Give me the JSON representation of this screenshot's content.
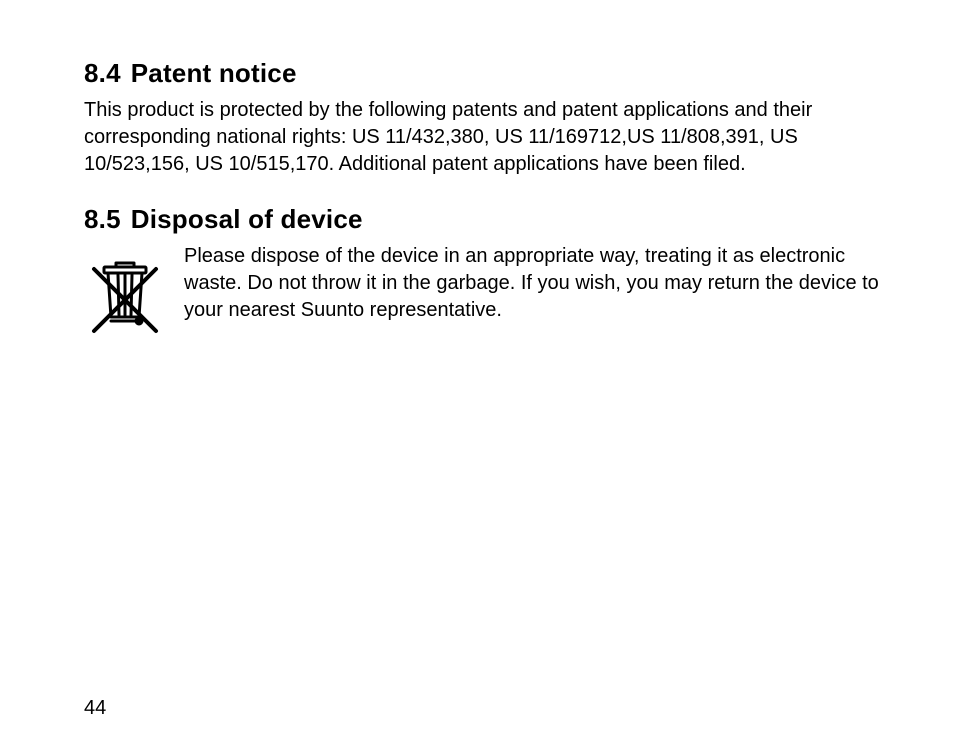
{
  "section1": {
    "number": "8.4",
    "title": "Patent notice",
    "body": "This product is protected by the following patents and patent applications and their corresponding national rights: US 11/432,380, US 11/169712,US 11/808,391, US 10/523,156, US 10/515,170. Additional patent applications have been filed."
  },
  "section2": {
    "number": "8.5",
    "title": "Disposal of device",
    "body": "Please dispose of the device in an appropriate way, treating it as electronic waste. Do not throw it in the garbage. If you wish, you may return the device to your nearest Suunto representative.",
    "icon": "weee-crossed-out-bin-icon"
  },
  "page_number": "44"
}
